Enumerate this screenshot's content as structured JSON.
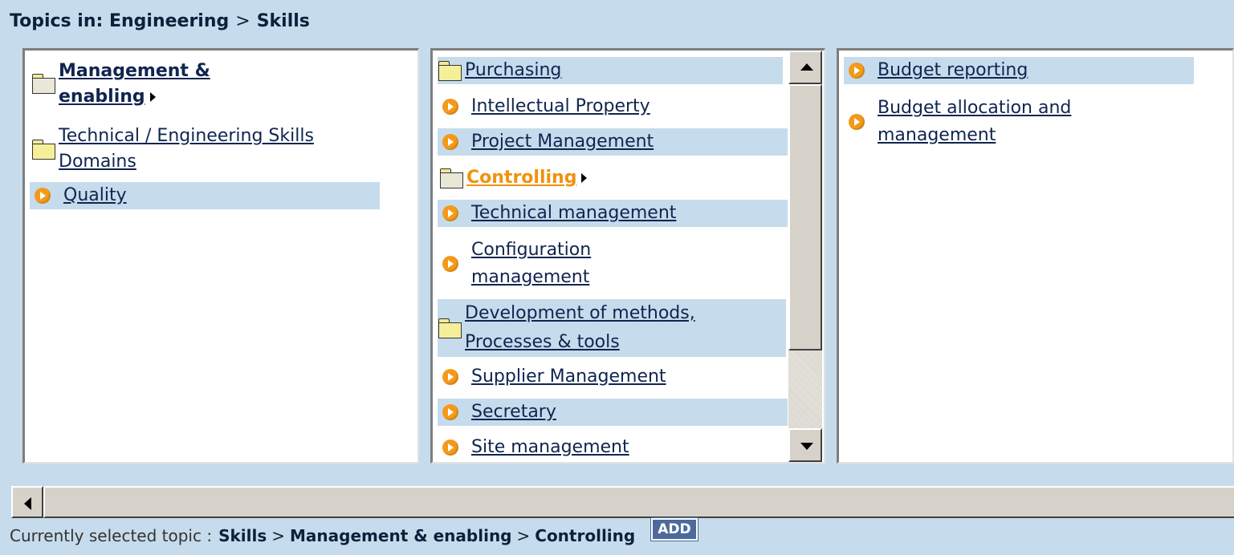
{
  "header": {
    "prefix": "Topics in:",
    "crumb1": "Engineering",
    "sep": ">",
    "crumb2": "Skills"
  },
  "column1": [
    {
      "label": "Management & enabling",
      "icon": "folder-open-icon",
      "bold": true,
      "expanded": true
    },
    {
      "label": "Technical / Engineering Skills Domains",
      "icon": "folder-icon"
    },
    {
      "label": "Quality",
      "icon": "arrow-circle-icon",
      "selected": true
    }
  ],
  "column2": [
    {
      "label": "Purchasing",
      "icon": "folder-icon",
      "selected": true
    },
    {
      "label": "Intellectual Property",
      "icon": "arrow-circle-icon"
    },
    {
      "label": "Project Management",
      "icon": "arrow-circle-icon",
      "selected": true
    },
    {
      "label": "Controlling",
      "icon": "folder-open-icon",
      "active": true
    },
    {
      "label": "Technical management",
      "icon": "arrow-circle-icon",
      "selected": true
    },
    {
      "label": "Configuration management",
      "icon": "arrow-circle-icon"
    },
    {
      "label": "Development of methods, Processes & tools",
      "icon": "folder-icon",
      "selected": true
    },
    {
      "label": "Supplier Management",
      "icon": "arrow-circle-icon"
    },
    {
      "label": "Secretary",
      "icon": "arrow-circle-icon",
      "selected": true
    },
    {
      "label": "Site management",
      "icon": "arrow-circle-icon"
    }
  ],
  "column3": [
    {
      "label": "Budget reporting",
      "icon": "arrow-circle-icon",
      "selected": true
    },
    {
      "label": "Budget allocation and management",
      "icon": "arrow-circle-icon"
    }
  ],
  "footer": {
    "prefix": "Currently selected topic :",
    "path1": "Skills",
    "sep": ">",
    "path2": "Management & enabling",
    "path3": "Controlling",
    "add_label": "ADD"
  },
  "colors": {
    "background": "#c6dcec",
    "link": "#10254f",
    "active": "#f0920e",
    "icon_orange": "#f39a1b",
    "add_button": "#4c6a9c"
  }
}
